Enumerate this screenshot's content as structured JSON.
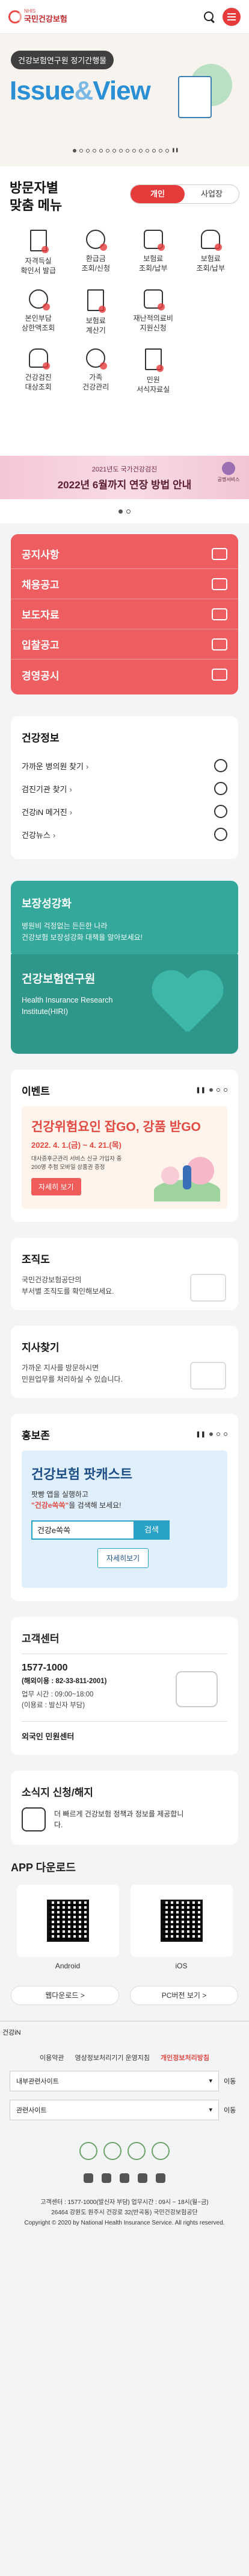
{
  "header": {
    "logo_top": "국민건강보험",
    "logo_sub": "NHIS"
  },
  "banner": {
    "pill": "건강보험연구원 정기간행물",
    "title_a": "Issue",
    "title_amp": "&",
    "title_b": "View"
  },
  "custom_menu": {
    "title_line1": "방문자별",
    "title_line2": "맞춤 메뉴",
    "tabs": [
      "개인",
      "사업장"
    ],
    "items": [
      {
        "line1": "자격득실",
        "line2": "확인서 발급"
      },
      {
        "line1": "환급금",
        "line2": "조회/신청"
      },
      {
        "line1": "보험료",
        "line2": "조회/납부"
      },
      {
        "line1": "보험료",
        "line2": "조회/납부"
      },
      {
        "line1": "본인부담",
        "line2": "상한액조회"
      },
      {
        "line1": "보험료",
        "line2": "계산기"
      },
      {
        "line1": "재난적의료비",
        "line2": "지원신청"
      },
      {
        "line1": "",
        "line2": ""
      },
      {
        "line1": "건강검진",
        "line2": "대상조회"
      },
      {
        "line1": "가족",
        "line2": "건강관리"
      },
      {
        "line1": "민원",
        "line2": "서식자료실"
      }
    ]
  },
  "promo": {
    "line1": "2021년도 국가건강검진",
    "line2": "2022년 6월까지 연장 방법 안내",
    "badge": "공명서비스"
  },
  "notice_menu": [
    "공지사항",
    "채용공고",
    "보도자료",
    "입찰공고",
    "경영공시"
  ],
  "health_info": {
    "title": "건강정보",
    "rows": [
      "가까운 병의원 찾기",
      "검진기관 찾기",
      "건강iN 메거진",
      "건강뉴스"
    ]
  },
  "coverage": {
    "title": "보장성강화",
    "desc_line1": "병원비 걱정없는 든든한 나라",
    "desc_line2": "건강보험 보장성강화 대책을 알아보세요!"
  },
  "research": {
    "title": "건강보험연구원",
    "en_line1": "Health Insurance Research",
    "en_line2": "Institute(HIRI)"
  },
  "event": {
    "title": "이벤트",
    "headline": "건강위험요인 잡GO, 강품 받GO",
    "period": "2022. 4. 1.(금) ~ 4. 21.(목)",
    "desc_line1": "대사증후군관리 서비스 신규 가입자 중",
    "desc_line2": "200명 추첨 모바일 상품권 증정",
    "button": "자세히 보기"
  },
  "org": {
    "title": "조직도",
    "desc_line1": "국민건강보험공단의",
    "desc_line2": "부서별 조직도를 확인해보세요."
  },
  "branch": {
    "title": "지사찾기",
    "desc_line1": "가까운 지사를 방문하시면",
    "desc_line2": "민원업무를 처리하실 수 있습니다."
  },
  "pr": {
    "title": "홍보존",
    "headline": "건강보험 팟캐스트",
    "desc_line1": "팟빵 앱을 실행하고",
    "desc_quote": "\"건강e쏙쏙\"",
    "desc_tail": "을 검색해 보세요!",
    "search_value": "건강e쏙쏙",
    "search_btn": "검색",
    "more": "자세히보기"
  },
  "customer": {
    "title": "고객센터",
    "tel": "1577-1000",
    "tel_foreign": "(해외이용 : 82-33-811-2001)",
    "hours1": "업무 시간 : 09:00~18:00",
    "hours2": "(이용료 : 발신자 부담)",
    "foreign": "외국인 민원센터"
  },
  "receipt": {
    "title": "소식지 신청/해지",
    "desc_line1": "더 빠르게 건강보험 정책과 정보를 제공합니",
    "desc_line2": "다."
  },
  "app": {
    "title": "APP 다운로드",
    "items": [
      "Android",
      "iOS"
    ]
  },
  "links": [
    "웹다운로드 >",
    "PC버전 보기 >"
  ],
  "footer": {
    "label": "건강iN",
    "links": [
      "이용약관",
      "영상정보처리기기 운영지침",
      "개인정보처리방침"
    ],
    "selects": [
      "내부관련사이트",
      "관련사이트"
    ],
    "go": "이동",
    "addr_line1": "고객센터 : 1577-1000(발신자 부담) 업무시간 : 09시 ~ 18시(월~금)",
    "addr_line2": "26464 강원도 원주시 건강로 32(반곡동) 국민건강보험공단",
    "copyright": "Copyright © 2020 by National Health Insurance Service. All rights reserved."
  },
  "colors": {
    "accent": "#e63b3b",
    "notice_card": "#ee5e60",
    "teal": "#34a89a"
  }
}
